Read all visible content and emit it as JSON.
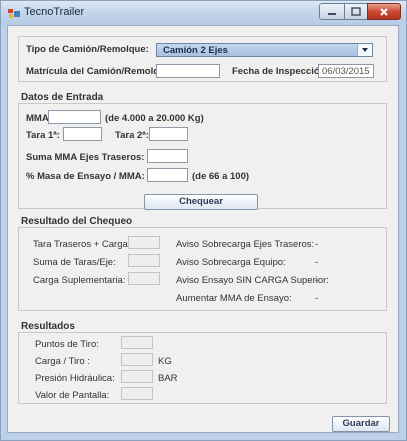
{
  "window": {
    "title": "TecnoTrailer"
  },
  "vehicle": {
    "tipo_label": "Tipo de Camión/Remolque:",
    "tipo_value": "Camión 2 Ejes",
    "matricula_label": "Matrícula del Camión/Remolque:",
    "matricula_value": "",
    "fecha_label": "Fecha de Inspección:",
    "fecha_value": "06/03/2015"
  },
  "entrada": {
    "title": "Datos de Entrada",
    "mma_label": "MMA:",
    "mma_hint": "(de 4.000 a 20.000 Kg)",
    "tara1_label": "Tara 1ª:",
    "tara2_label": "Tara 2ª:",
    "suma_label": "Suma MMA Ejes Traseros:",
    "masa_label": "% Masa de Ensayo / MMA:",
    "masa_hint": "(de 66 a 100)"
  },
  "chequear_label": "Chequear",
  "chequeo": {
    "title": "Resultado del Chequeo",
    "tara_traseros_label": "Tara Traseros + Carga:",
    "suma_taras_label": "Suma de Taras/Eje:",
    "carga_supl_label": "Carga Suplementaria:",
    "aviso_ejes_label": "Aviso Sobrecarga Ejes Traseros:",
    "aviso_equipo_label": "Aviso Sobrecarga Equipo:",
    "aviso_ensayo_label": "Aviso Ensayo SIN CARGA Superior:",
    "aumentar_label": "Aumentar MMA de Ensayo:",
    "aviso_ejes_value": "-",
    "aviso_equipo_value": "-",
    "aviso_ensayo_value": "-",
    "aumentar_value": "-"
  },
  "resultados": {
    "title": "Resultados",
    "puntos_label": "Puntos de Tiro:",
    "carga_label": "Carga / Tiro :",
    "carga_unit": "KG",
    "presion_label": "Presión Hidráulica:",
    "presion_unit": "BAR",
    "valor_label": "Valor de Pantalla:"
  },
  "guardar_label": "Guardar"
}
